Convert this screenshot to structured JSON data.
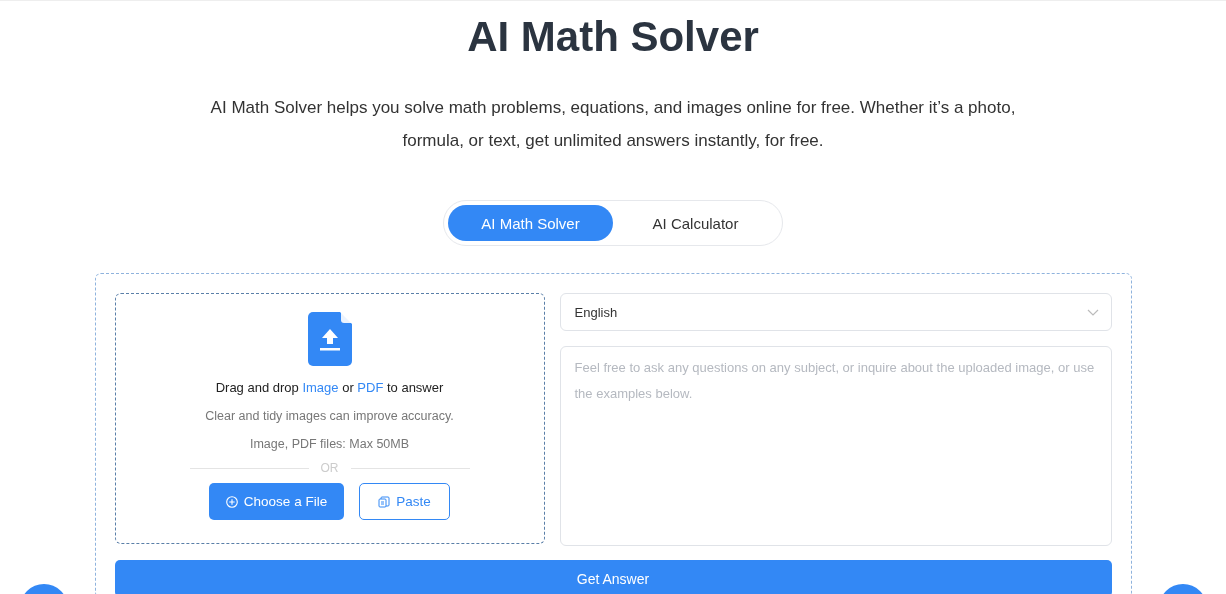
{
  "title": "AI Math Solver",
  "subtitle": "AI Math Solver helps you solve math problems, equations, and images online for free. Whether it’s a photo, formula, or text, get unlimited answers instantly, for free.",
  "tabs": [
    {
      "label": "AI Math Solver",
      "selected": true
    },
    {
      "label": "AI Calculator",
      "selected": false
    }
  ],
  "upload": {
    "prompt": [
      {
        "kind": "text",
        "text": "Drag and drop "
      },
      {
        "kind": "link",
        "text": "Image"
      },
      {
        "kind": "text",
        "text": " or "
      },
      {
        "kind": "link",
        "text": "PDF"
      },
      {
        "kind": "text",
        "text": " to answer"
      }
    ],
    "hint": "Clear and tidy images can improve accuracy.",
    "limit": "Image, PDF files: Max 50MB",
    "divider": "OR",
    "choose_button": "Choose a File",
    "paste_button": "Paste"
  },
  "language": {
    "value": "English"
  },
  "question": {
    "placeholder": "Feel free to ask any questions on any subject, or inquire about the uploaded image, or use the examples below."
  },
  "submit_button": "Get Answer"
}
